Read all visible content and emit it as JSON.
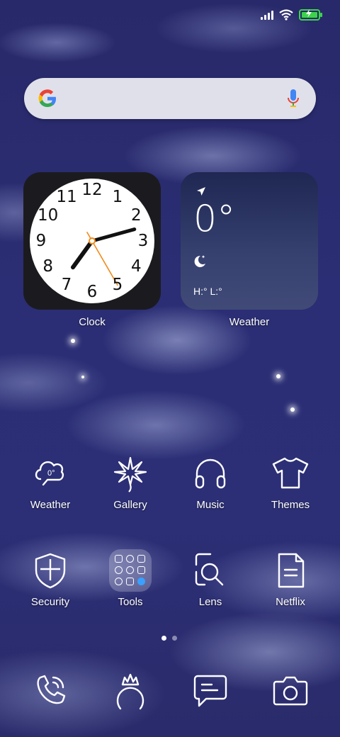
{
  "status_bar": {
    "signal_icon": "signal-bars-icon",
    "wifi_icon": "wifi-icon",
    "battery_icon": "battery-charging-icon",
    "battery_color": "#3cd34a"
  },
  "search_bar": {
    "logo_icon": "google-logo-icon",
    "mic_icon": "microphone-icon"
  },
  "widgets": {
    "clock": {
      "label": "Clock",
      "numbers": [
        "12",
        "1",
        "2",
        "3",
        "4",
        "5",
        "6",
        "7",
        "8",
        "9",
        "10",
        "11"
      ],
      "time": {
        "hour": 7,
        "minute": 12,
        "second": 26
      },
      "second_hand_color": "#f08a1a"
    },
    "weather": {
      "label": "Weather",
      "location_icon": "location-arrow-icon",
      "temperature": "0°",
      "condition_icon": "moon-stars-icon",
      "high_low": "H:° L:°"
    }
  },
  "apps_row1": [
    {
      "label": "Weather",
      "icon": "weather-icon",
      "badge": "0°"
    },
    {
      "label": "Gallery",
      "icon": "gallery-flower-icon"
    },
    {
      "label": "Music",
      "icon": "headphones-icon"
    },
    {
      "label": "Themes",
      "icon": "tshirt-icon"
    }
  ],
  "apps_row2": [
    {
      "label": "Security",
      "icon": "shield-icon"
    },
    {
      "label": "Tools",
      "icon": "folder-icon"
    },
    {
      "label": "Lens",
      "icon": "lens-search-icon"
    },
    {
      "label": "Netflix",
      "icon": "document-icon"
    }
  ],
  "page_indicator": {
    "pages": 2,
    "current": 1
  },
  "dock": [
    {
      "name": "phone",
      "icon": "phone-icon"
    },
    {
      "name": "browser",
      "icon": "crown-ring-icon"
    },
    {
      "name": "messages",
      "icon": "message-icon"
    },
    {
      "name": "camera",
      "icon": "camera-icon"
    }
  ]
}
